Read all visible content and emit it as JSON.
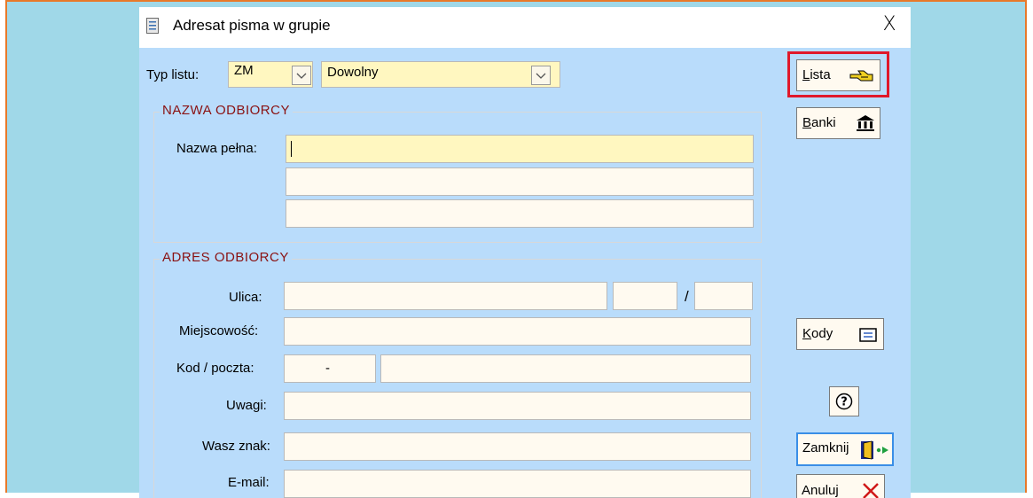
{
  "window": {
    "title": "Adresat pisma w grupie",
    "close": "X"
  },
  "typ_listu": {
    "label": "Typ listu:",
    "code": "ZM",
    "value": "Dowolny"
  },
  "nazwa_group": {
    "title": "NAZWA ODBIORCY",
    "label": "Nazwa pełna:",
    "line1": "",
    "line2": "",
    "line3": ""
  },
  "adres_group": {
    "title": "ADRES ODBIORCY",
    "ulica_label": "Ulica:",
    "house_sep": "/",
    "miejscowosc_label": "Miejscowość:",
    "kod_label": "Kod / poczta:",
    "kod_value": "-",
    "uwagi_label": "Uwagi:",
    "wasz_znak_label": "Wasz znak:",
    "email_label": "E-mail:"
  },
  "buttons": {
    "lista_first": "L",
    "lista_rest": "ista",
    "banki_first": "B",
    "banki_rest": "anki",
    "kody_first": "K",
    "kody_rest": "ody",
    "help": "?",
    "zamknij": "Zamknij",
    "anuluj": "Anuluj"
  },
  "icons": {
    "lista": "pointing-hand-icon",
    "banki": "bank-icon",
    "kody": "envelope-icon",
    "help": "question-icon",
    "zamknij": "exit-door-icon",
    "anuluj": "red-x-icon"
  },
  "colors": {
    "background_outer": "#a0d8e8",
    "dialog_body": "#b9dcfb",
    "input_yellow": "#fff7c0",
    "input_cream": "#fffaf0",
    "group_title": "#8a1212",
    "highlight_red": "#e0182a",
    "frame_orange": "#e8792a"
  }
}
